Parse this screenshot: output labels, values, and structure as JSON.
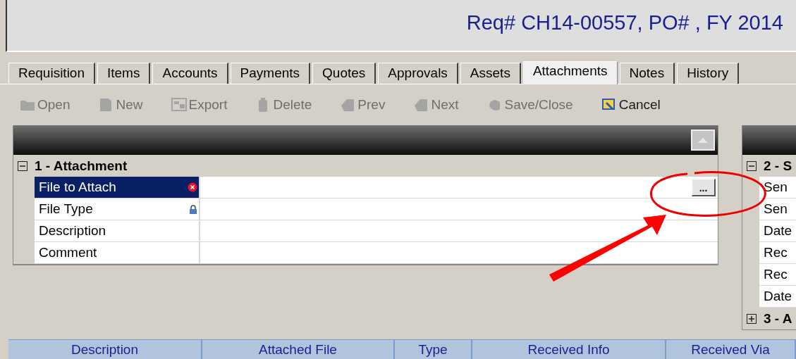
{
  "window": {
    "title": "Req# CH14-00557, PO# , FY 2014"
  },
  "tabs": [
    {
      "label": "Requisition",
      "selected": false
    },
    {
      "label": "Items",
      "selected": false
    },
    {
      "label": "Accounts",
      "selected": false
    },
    {
      "label": "Payments",
      "selected": false
    },
    {
      "label": "Quotes",
      "selected": false
    },
    {
      "label": "Approvals",
      "selected": false
    },
    {
      "label": "Assets",
      "selected": false
    },
    {
      "label": "Attachments",
      "selected": true
    },
    {
      "label": "Notes",
      "selected": false
    },
    {
      "label": "History",
      "selected": false
    }
  ],
  "toolbar": [
    {
      "kind": "open",
      "label": "Open",
      "disabled": true
    },
    {
      "kind": "new",
      "label": "New",
      "disabled": true
    },
    {
      "kind": "export",
      "label": "Export",
      "disabled": true
    },
    {
      "kind": "delete",
      "label": "Delete",
      "disabled": true
    },
    {
      "kind": "prev",
      "label": "Prev",
      "disabled": true
    },
    {
      "kind": "next",
      "label": "Next",
      "disabled": true
    },
    {
      "kind": "save",
      "label": "Save/Close",
      "disabled": true
    },
    {
      "kind": "cancel",
      "label": "Cancel",
      "disabled": false
    }
  ],
  "attachment_section": {
    "title": "1 - Attachment",
    "expanded": true,
    "rows": [
      {
        "label": "File to Attach",
        "kind": "required",
        "selected": true,
        "button": "..."
      },
      {
        "label": "File Type",
        "kind": "locked",
        "selected": false
      },
      {
        "label": "Description",
        "kind": "plain",
        "selected": false
      },
      {
        "label": "Comment",
        "kind": "plain",
        "selected": false
      }
    ]
  },
  "side_sections": [
    {
      "title": "2 - S",
      "expanded": true,
      "rows": [
        "Sen",
        "Sen",
        "Date",
        "Rec",
        "Rec",
        "Date"
      ]
    },
    {
      "title": "3 - A",
      "expanded": false
    }
  ],
  "grid": {
    "columns": [
      "Description",
      "Attached File",
      "Type",
      "Received Info",
      "Received Via"
    ]
  }
}
